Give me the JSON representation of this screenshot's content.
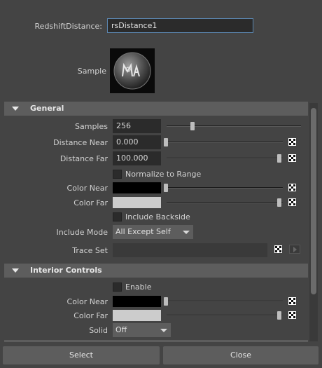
{
  "header": {
    "name_label": "RedshiftDistance:",
    "name_value": "rsDistance1",
    "sample_label": "Sample"
  },
  "general": {
    "title": "General",
    "samples_label": "Samples",
    "samples_value": "256",
    "distance_near_label": "Distance Near",
    "distance_near_value": "0.000",
    "distance_far_label": "Distance Far",
    "distance_far_value": "100.000",
    "normalize_label": "Normalize to Range",
    "color_near_label": "Color Near",
    "color_near_hex": "#000000",
    "color_far_label": "Color Far",
    "color_far_hex": "#cccccc",
    "include_backside_label": "Include Backside",
    "include_mode_label": "Include Mode",
    "include_mode_value": "All Except Self",
    "trace_set_label": "Trace Set"
  },
  "interior": {
    "title": "Interior Controls",
    "enable_label": "Enable",
    "color_near_label": "Color Near",
    "color_near_hex": "#000000",
    "color_far_label": "Color Far",
    "color_far_hex": "#cccccc",
    "solid_label": "Solid",
    "solid_value": "Off"
  },
  "footer": {
    "select_label": "Select",
    "close_label": "Close"
  },
  "colors": {
    "background": "#444444",
    "section_header": "#5d5d5d",
    "field": "#2b2b2b",
    "focus_border": "#5b86b0"
  },
  "icons": [
    "maya-logo-icon",
    "checker-map-icon",
    "collapse-triangle-icon",
    "dropdown-arrow-icon",
    "input-arrow-icon"
  ]
}
